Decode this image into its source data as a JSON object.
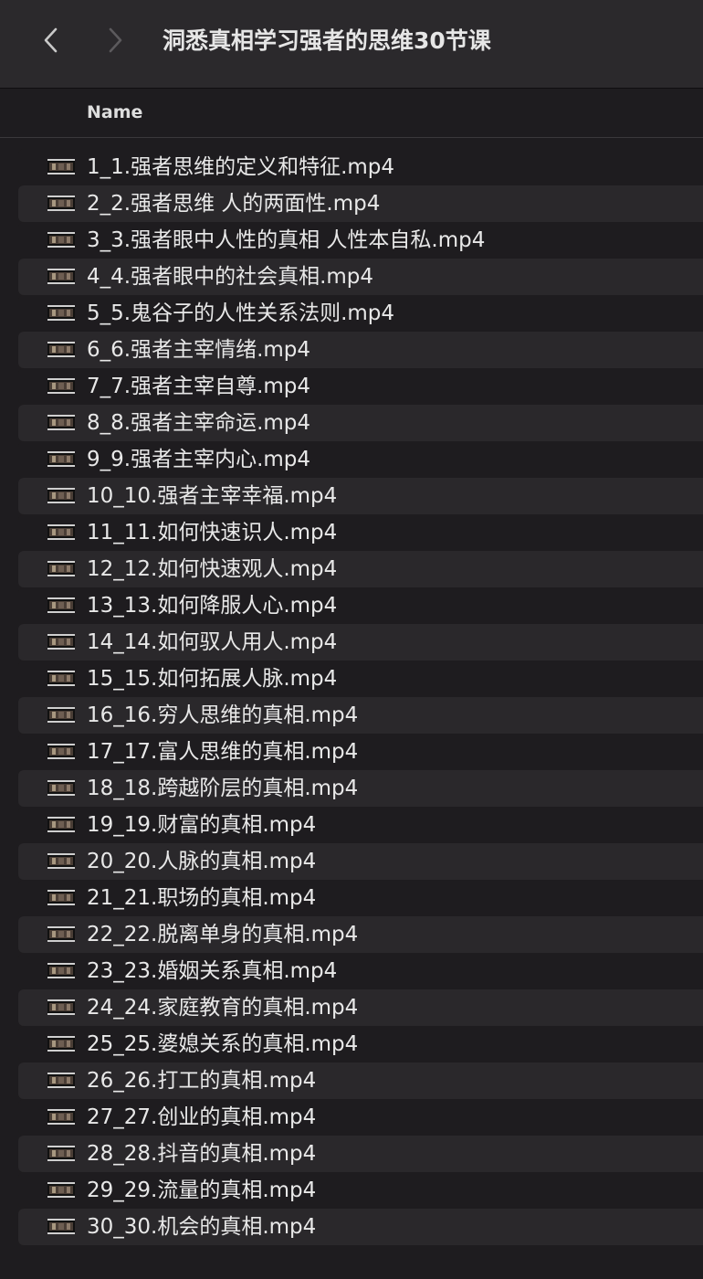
{
  "window": {
    "title": "洞悉真相学习强者的思维30节课"
  },
  "toolbar": {
    "back_icon": "chevron-left-icon",
    "forward_icon": "chevron-right-icon"
  },
  "header": {
    "name_label": "Name"
  },
  "files": [
    {
      "name": "1_1.强者思维的定义和特征.mp4"
    },
    {
      "name": "2_2.强者思维 人的两面性.mp4"
    },
    {
      "name": "3_3.强者眼中人性的真相 人性本自私.mp4"
    },
    {
      "name": "4_4.强者眼中的社会真相.mp4"
    },
    {
      "name": "5_5.鬼谷子的人性关系法则.mp4"
    },
    {
      "name": "6_6.强者主宰情绪.mp4"
    },
    {
      "name": "7_7.强者主宰自尊.mp4"
    },
    {
      "name": "8_8.强者主宰命运.mp4"
    },
    {
      "name": "9_9.强者主宰内心.mp4"
    },
    {
      "name": "10_10.强者主宰幸福.mp4"
    },
    {
      "name": "11_11.如何快速识人.mp4"
    },
    {
      "name": "12_12.如何快速观人.mp4"
    },
    {
      "name": "13_13.如何降服人心.mp4"
    },
    {
      "name": "14_14.如何驭人用人.mp4"
    },
    {
      "name": "15_15.如何拓展人脉.mp4"
    },
    {
      "name": "16_16.穷人思维的真相.mp4"
    },
    {
      "name": "17_17.富人思维的真相.mp4"
    },
    {
      "name": "18_18.跨越阶层的真相.mp4"
    },
    {
      "name": "19_19.财富的真相.mp4"
    },
    {
      "name": "20_20.人脉的真相.mp4"
    },
    {
      "name": "21_21.职场的真相.mp4"
    },
    {
      "name": "22_22.脱离单身的真相.mp4"
    },
    {
      "name": "23_23.婚姻关系真相.mp4"
    },
    {
      "name": "24_24.家庭教育的真相.mp4"
    },
    {
      "name": "25_25.婆媳关系的真相.mp4"
    },
    {
      "name": "26_26.打工的真相.mp4"
    },
    {
      "name": "27_27.创业的真相.mp4"
    },
    {
      "name": "28_28.抖音的真相.mp4"
    },
    {
      "name": "29_29.流量的真相.mp4"
    },
    {
      "name": "30_30.机会的真相.mp4"
    }
  ],
  "file_icon": "video-thumbnail-icon"
}
